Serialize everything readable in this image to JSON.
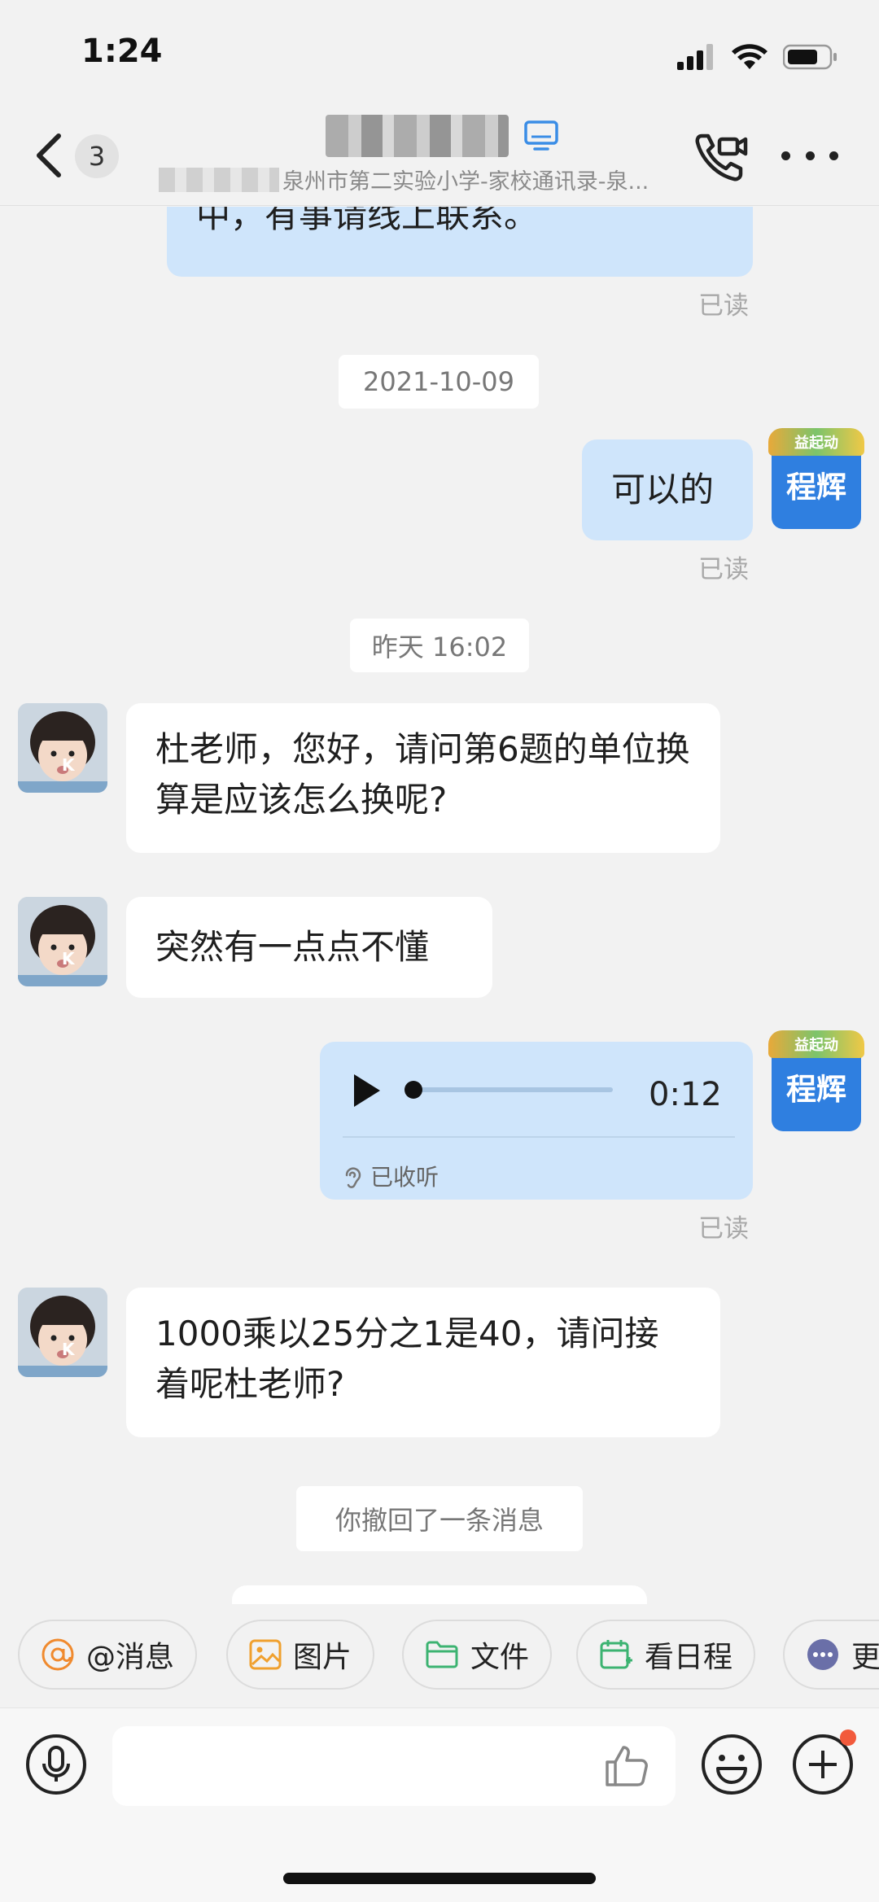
{
  "status_bar": {
    "time": "1:24"
  },
  "header": {
    "unread_count": "3",
    "subtitle": "泉州市第二实验小学-家校通讯录-泉..."
  },
  "messages": {
    "m1_text": "中，有事请线上联系。",
    "m1_read": "已读",
    "date1": "2021-10-09",
    "m2_text": "可以的",
    "m2_read": "已读",
    "date2": "昨天 16:02",
    "m3_text": "杜老师，您好，请问第6题的单位换算是应该怎么换呢?",
    "m4_text": "突然有一点点不懂",
    "voice_duration": "0:12",
    "voice_progress": 0,
    "voice_status": "已收听",
    "voice_read": "已读",
    "m6_text": "1000乘以25分之1是40，请问接着呢杜老师?",
    "recall_text": "你撤回了一条消息"
  },
  "avatars": {
    "me_name": "程辉",
    "me_decoration": "益起动",
    "child_initial": "K"
  },
  "quick_actions": [
    "@消息",
    "图片",
    "文件",
    "看日程",
    "更"
  ],
  "input": {
    "value": ""
  },
  "colors": {
    "outgoing_bubble": "#cfe5fb",
    "avatar_blue": "#2f7fe0",
    "background": "#f2f2f2"
  }
}
